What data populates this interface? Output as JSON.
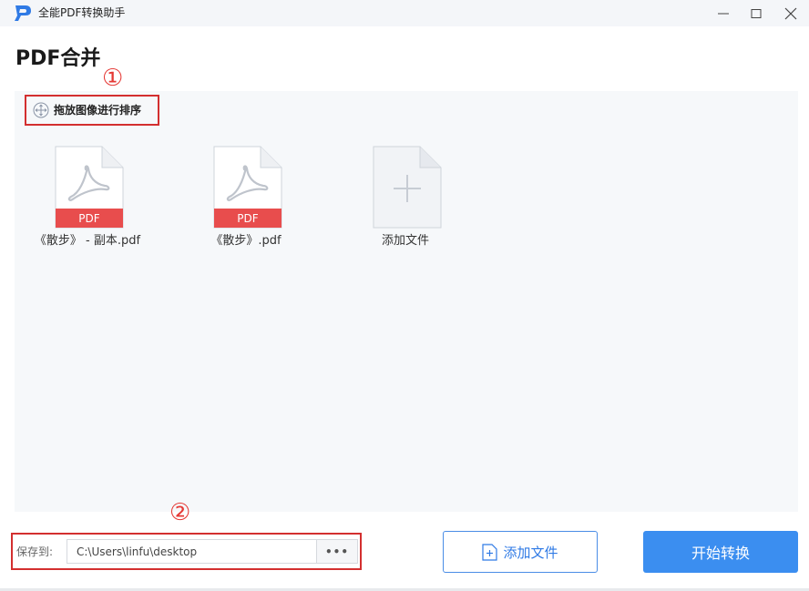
{
  "window": {
    "title": "全能PDF转换助手",
    "icons": {
      "logo": "app-logo-p-icon",
      "minimize": "minimize-icon",
      "maximize": "maximize-icon",
      "close": "close-icon"
    }
  },
  "page": {
    "title": "PDF合并"
  },
  "markers": {
    "one": "①",
    "two": "②"
  },
  "sort_hint": {
    "label": "拖放图像进行排序",
    "icon": "move-arrows-icon"
  },
  "files": [
    {
      "name": "《散步》 - 副本.pdf",
      "badge": "PDF"
    },
    {
      "name": "《散步》.pdf",
      "badge": "PDF"
    }
  ],
  "add_tile": {
    "label": "添加文件",
    "icon": "plus-icon"
  },
  "save": {
    "label": "保存到:",
    "path": "C:\\Users\\linfu\\desktop",
    "browse_label": "•••"
  },
  "actions": {
    "add_file": "添加文件",
    "start": "开始转换"
  },
  "colors": {
    "accent": "#3b8ef0",
    "pdf_red": "#e84d4d",
    "highlight_red": "#d32f2f"
  }
}
